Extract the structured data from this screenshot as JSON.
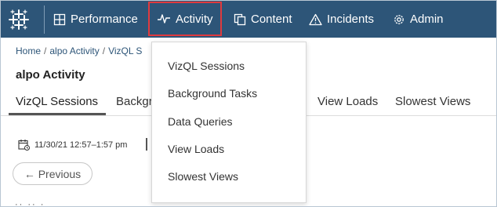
{
  "nav": {
    "items": [
      {
        "label": "Performance",
        "icon": "grid-icon"
      },
      {
        "label": "Activity",
        "icon": "pulse-icon"
      },
      {
        "label": "Content",
        "icon": "copy-icon"
      },
      {
        "label": "Incidents",
        "icon": "warning-icon"
      },
      {
        "label": "Admin",
        "icon": "gear-icon"
      }
    ],
    "highlight_color": "#e03a3e",
    "bar_color": "#2d5578"
  },
  "breadcrumb": {
    "home": "Home",
    "parent": "alpo Activity",
    "current": "VizQL S"
  },
  "page_title": "alpo Activity",
  "tabs": [
    {
      "label": "VizQL Sessions",
      "active": true
    },
    {
      "label": "Backgr"
    },
    {
      "label": "View Loads"
    },
    {
      "label": "Slowest Views"
    }
  ],
  "date_range": "11/30/21 12:57–1:57 pm",
  "previous_button": "← Previous",
  "dropdown": {
    "items": [
      "VizQL Sessions",
      "Background Tasks",
      "Data Queries",
      "View Loads",
      "Slowest Views"
    ]
  }
}
